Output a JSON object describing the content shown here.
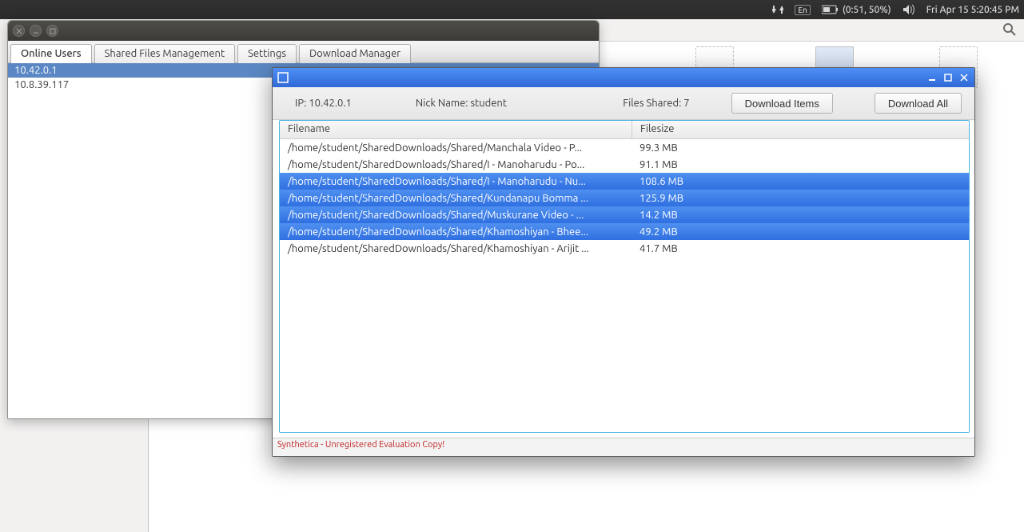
{
  "menubar": {
    "keyboard_indicator": "En",
    "battery_text": "(0:51, 50%)",
    "clock_text": "Fri Apr 15  5:20:45 PM"
  },
  "back_window": {
    "tabs": [
      {
        "label": "Online Users",
        "active": true
      },
      {
        "label": "Shared Files Management",
        "active": false
      },
      {
        "label": "Settings",
        "active": false
      },
      {
        "label": "Download Manager",
        "active": false
      }
    ],
    "users": [
      {
        "ip": "10.42.0.1",
        "selected": true
      },
      {
        "ip": "10.8.39.117",
        "selected": false
      }
    ]
  },
  "front_window": {
    "info": {
      "ip_label": "IP: ",
      "ip_value": "10.42.0.1",
      "nick_label": "Nick Name: ",
      "nick_value": "student",
      "count_label": "Files Shared: ",
      "count_value": "7",
      "btn_items": "Download Items",
      "btn_all": "Download All"
    },
    "columns": {
      "filename": "Filename",
      "filesize": "Filesize"
    },
    "files": [
      {
        "name": "/home/student/SharedDownloads/Shared/Manchala Video - P...",
        "size": "99.3 MB",
        "selected": false
      },
      {
        "name": "/home/student/SharedDownloads/Shared/I - Manoharudu - Po...",
        "size": "91.1 MB",
        "selected": false
      },
      {
        "name": "/home/student/SharedDownloads/Shared/I - Manoharudu - Nu...",
        "size": "108.6 MB",
        "selected": true
      },
      {
        "name": "/home/student/SharedDownloads/Shared/Kundanapu Bomma ...",
        "size": "125.9 MB",
        "selected": true
      },
      {
        "name": "/home/student/SharedDownloads/Shared/Muskurane Video - ...",
        "size": "14.2 MB",
        "selected": true
      },
      {
        "name": "/home/student/SharedDownloads/Shared/Khamoshiyan - Bhee...",
        "size": "49.2 MB",
        "selected": true
      },
      {
        "name": "/home/student/SharedDownloads/Shared/Khamoshiyan - Arijit ...",
        "size": "41.7 MB",
        "selected": false
      }
    ],
    "status": "Synthetica - Unregistered Evaluation Copy!"
  }
}
